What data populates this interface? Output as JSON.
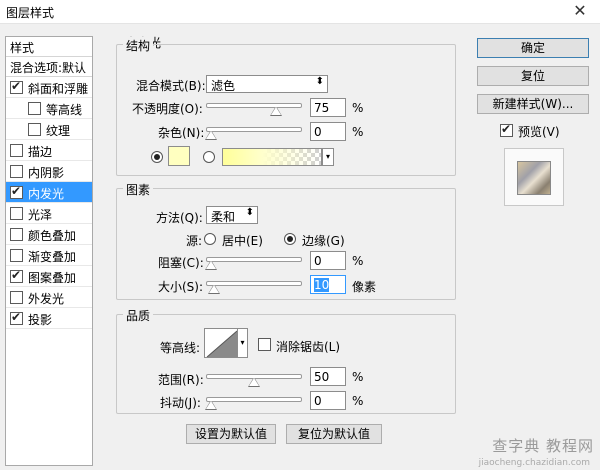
{
  "window": {
    "title": "图层样式"
  },
  "sidebar": {
    "header": "样式",
    "blend_options": "混合选项:默认",
    "items": [
      {
        "label": "斜面和浮雕",
        "checked": true,
        "selected": false,
        "indent": 0
      },
      {
        "label": "等高线",
        "checked": false,
        "selected": false,
        "indent": 1
      },
      {
        "label": "纹理",
        "checked": false,
        "selected": false,
        "indent": 1
      },
      {
        "label": "描边",
        "checked": false,
        "selected": false,
        "indent": 0
      },
      {
        "label": "内阴影",
        "checked": false,
        "selected": false,
        "indent": 0
      },
      {
        "label": "内发光",
        "checked": true,
        "selected": true,
        "indent": 0
      },
      {
        "label": "光泽",
        "checked": false,
        "selected": false,
        "indent": 0
      },
      {
        "label": "颜色叠加",
        "checked": false,
        "selected": false,
        "indent": 0
      },
      {
        "label": "渐变叠加",
        "checked": false,
        "selected": false,
        "indent": 0
      },
      {
        "label": "图案叠加",
        "checked": true,
        "selected": false,
        "indent": 0
      },
      {
        "label": "外发光",
        "checked": false,
        "selected": false,
        "indent": 0
      },
      {
        "label": "投影",
        "checked": true,
        "selected": false,
        "indent": 0
      }
    ]
  },
  "panel": {
    "title": "内发光",
    "structure": {
      "title": "结构",
      "blend_mode_label": "混合模式(B):",
      "blend_mode_value": "滤色",
      "opacity_label": "不透明度(O):",
      "opacity_value": "75",
      "opacity_fraction": 0.75,
      "noise_label": "杂色(N):",
      "noise_value": "0",
      "noise_fraction": 0,
      "unit": "%",
      "color_swatch": "#ffffc0"
    },
    "elements": {
      "title": "图素",
      "technique_label": "方法(Q):",
      "technique_value": "柔和",
      "source_label": "源:",
      "source_center": "居中(E)",
      "source_edge": "边缘(G)",
      "choke_label": "阻塞(C):",
      "choke_value": "0",
      "choke_fraction": 0,
      "size_label": "大小(S):",
      "size_value": "10",
      "size_fraction": 0.04,
      "unit_pct": "%",
      "unit_px": "像素"
    },
    "quality": {
      "title": "品质",
      "contour_label": "等高线:",
      "antialias_label": "消除锯齿(L)",
      "range_label": "范围(R):",
      "range_value": "50",
      "range_fraction": 0.5,
      "jitter_label": "抖动(J):",
      "jitter_value": "0",
      "jitter_fraction": 0,
      "unit": "%"
    },
    "make_default": "设置为默认值",
    "reset_default": "复位为默认值"
  },
  "actions": {
    "ok": "确定",
    "reset": "复位",
    "new_style": "新建样式(W)...",
    "preview_label": "预览(V)",
    "preview_checked": true
  },
  "watermark": {
    "main": "查字典 教程网",
    "sub": "jiaocheng.chazidian.com"
  }
}
